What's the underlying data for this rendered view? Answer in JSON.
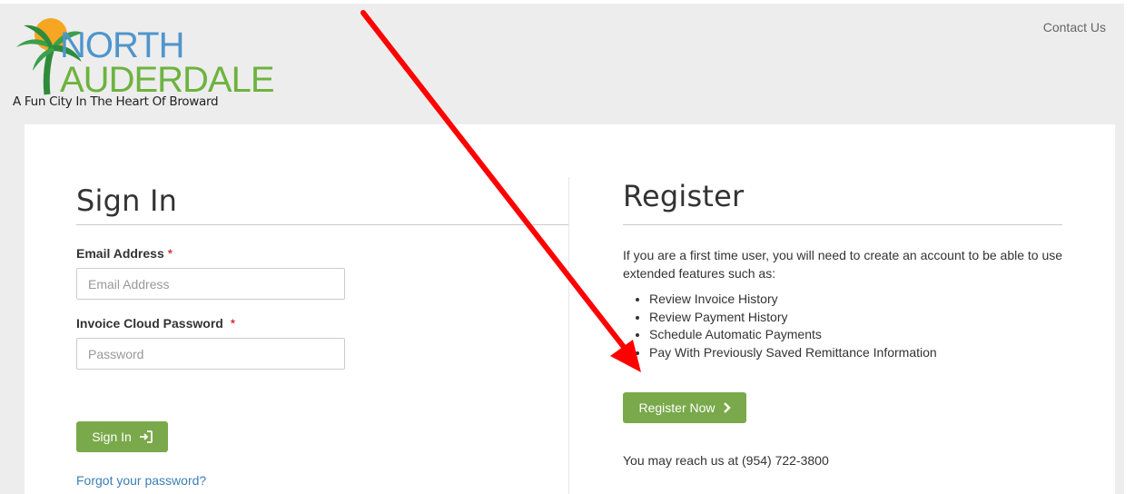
{
  "header": {
    "logo_north": "NORTH",
    "logo_lauderdale": "AUDERDALE",
    "logo_tagline": "A Fun City In The Heart Of Broward",
    "contact_label": "Contact Us"
  },
  "signin": {
    "title": "Sign In",
    "email_label": "Email Address",
    "email_placeholder": "Email Address",
    "password_label": "Invoice Cloud Password",
    "password_placeholder": "Password",
    "required_mark": "*",
    "button_label": "Sign In",
    "forgot_label": "Forgot your password?"
  },
  "register": {
    "title": "Register",
    "intro": "If you are a first time user, you will need to create an account to be able to use extended features such as:",
    "features": [
      "Review Invoice History",
      "Review Payment History",
      "Schedule Automatic Payments",
      "Pay With Previously Saved Remittance Information"
    ],
    "button_label": "Register Now",
    "contact_text": "You may reach us at (954) 722-3800"
  },
  "colors": {
    "button_green": "#79a94a",
    "link_blue": "#3b7fb6",
    "annotation_red": "#ff0000",
    "logo_blue": "#4f95cd",
    "logo_green": "#6db33f"
  },
  "icons": {
    "signin_button_icon": "sign-in-icon",
    "register_button_icon": "chevron-right-icon"
  }
}
